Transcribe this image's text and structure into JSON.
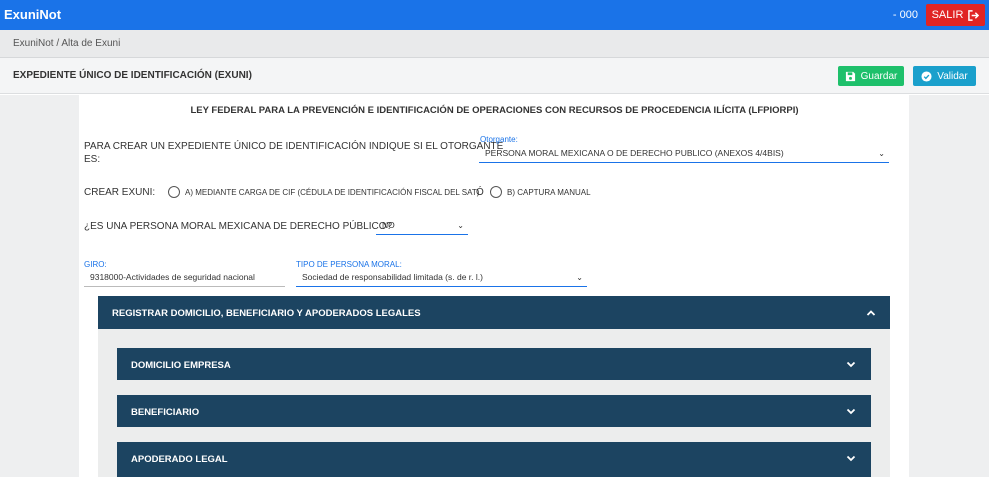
{
  "app": {
    "name": "ExuniNot",
    "user_code": "- 000",
    "exit_label": "SALIR"
  },
  "breadcrumb": "ExuniNot / Alta de Exuni",
  "page": {
    "title": "EXPEDIENTE ÚNICO DE IDENTIFICACIÓN (EXUNI)",
    "save_label": "Guardar",
    "validate_label": "Validar"
  },
  "form": {
    "law_title": "LEY FEDERAL PARA LA PREVENCIÓN E IDENTIFICACIÓN DE OPERACIONES CON RECURSOS DE PROCEDENCIA ILÍCITA (LFPIORPI)",
    "otorgante_question_l1": "PARA CREAR UN EXPEDIENTE ÚNICO DE IDENTIFICACIÓN INDIQUE SI EL OTORGANTE",
    "otorgante_question_l2": "ES:",
    "otorgante_label": "Otorgante:",
    "otorgante_value": "PERSONA MORAL MEXICANA O DE DERECHO PUBLICO (ANEXOS 4/4BIS)",
    "crear_label": "CREAR EXUNI:",
    "option_a": "A) MEDIANTE CARGA DE CIF (CÉDULA DE IDENTIFICACIÓN FISCAL DEL SAT)",
    "option_or": "Ó",
    "option_b": "B) CAPTURA MANUAL",
    "publico_question": "¿ES UNA PERSONA MORAL MEXICANA DE DERECHO PÚBLICO?",
    "publico_value": "NO",
    "giro_label": "GIRO:",
    "giro_value": "9318000-Actividades de seguridad nacional",
    "tipo_label": "TIPO DE PERSONA MORAL:",
    "tipo_value": "Sociedad de responsabilidad limitada (s. de r. l.)"
  },
  "sections": {
    "main": "REGISTRAR DOMICILIO, BENEFICIARIO Y APODERADOS LEGALES",
    "items": [
      "DOMICILIO EMPRESA",
      "BENEFICIARIO",
      "APODERADO LEGAL"
    ]
  },
  "colors": {
    "topbar": "#1a73e8",
    "exit": "#e02424",
    "save": "#1ec06b",
    "validate": "#1aa0cc",
    "panel": "#1c4461"
  }
}
